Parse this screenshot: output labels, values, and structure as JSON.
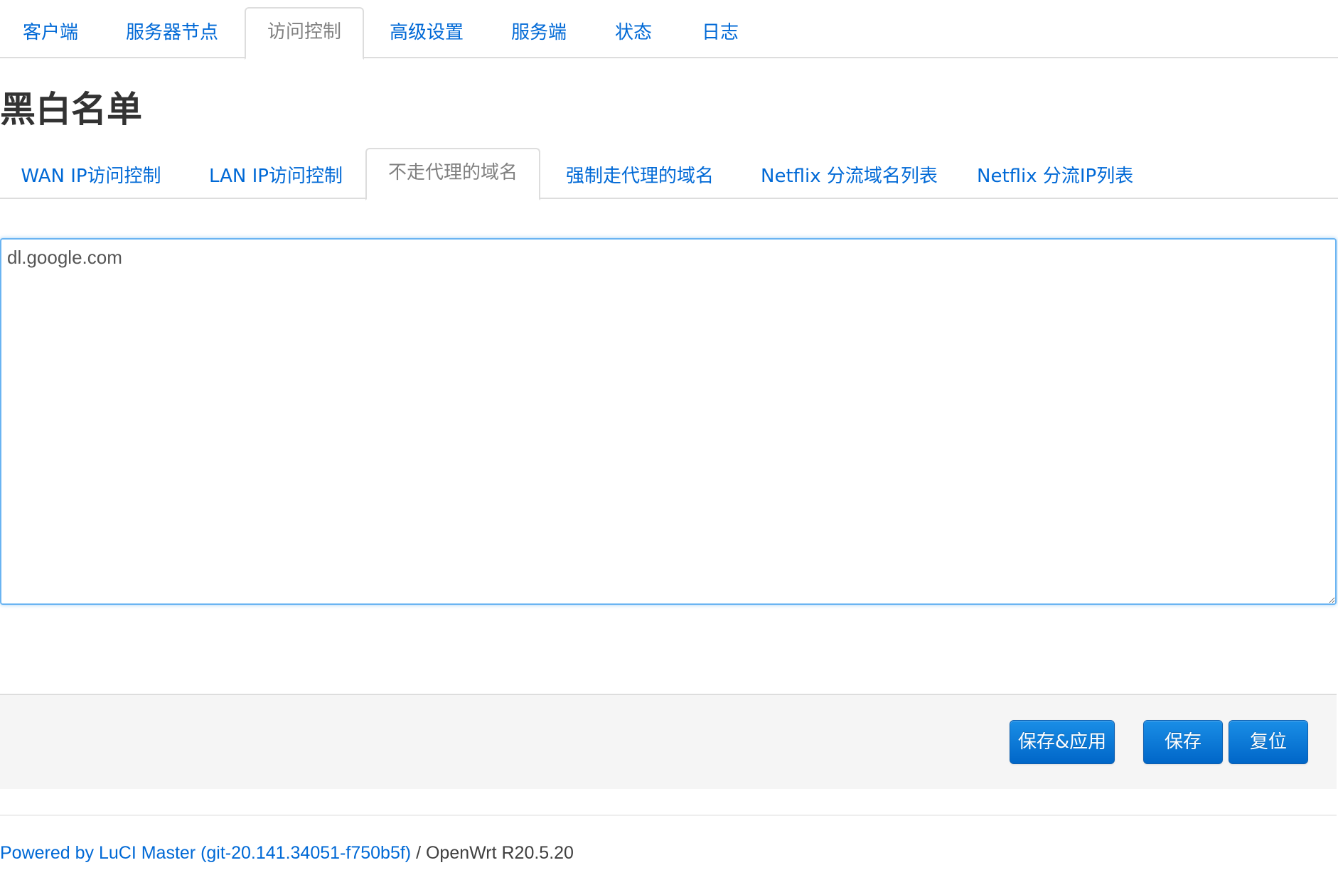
{
  "main_tabs": [
    {
      "label": "客户端"
    },
    {
      "label": "服务器节点"
    },
    {
      "label": "访问控制",
      "active": true
    },
    {
      "label": "高级设置"
    },
    {
      "label": "服务端"
    },
    {
      "label": "状态"
    },
    {
      "label": "日志"
    }
  ],
  "section": {
    "title": "黑白名单"
  },
  "sub_tabs": [
    {
      "label": "WAN IP访问控制"
    },
    {
      "label": "LAN IP访问控制"
    },
    {
      "label": "不走代理的域名",
      "active": true
    },
    {
      "label": "强制走代理的域名"
    },
    {
      "label": "Netflix 分流域名列表"
    },
    {
      "label": "Netflix 分流IP列表"
    }
  ],
  "editor": {
    "value": "dl.google.com"
  },
  "actions": {
    "save_apply": "保存&应用",
    "save": "保存",
    "reset": "复位"
  },
  "footer": {
    "link_text": "Powered by LuCI Master (git-20.141.34051-f750b5f)",
    "separator": " / ",
    "version": "OpenWrt R20.5.20"
  },
  "colors": {
    "link": "#0069d6",
    "button": "#0a74d6",
    "focus_border": "#6ab4f2"
  }
}
